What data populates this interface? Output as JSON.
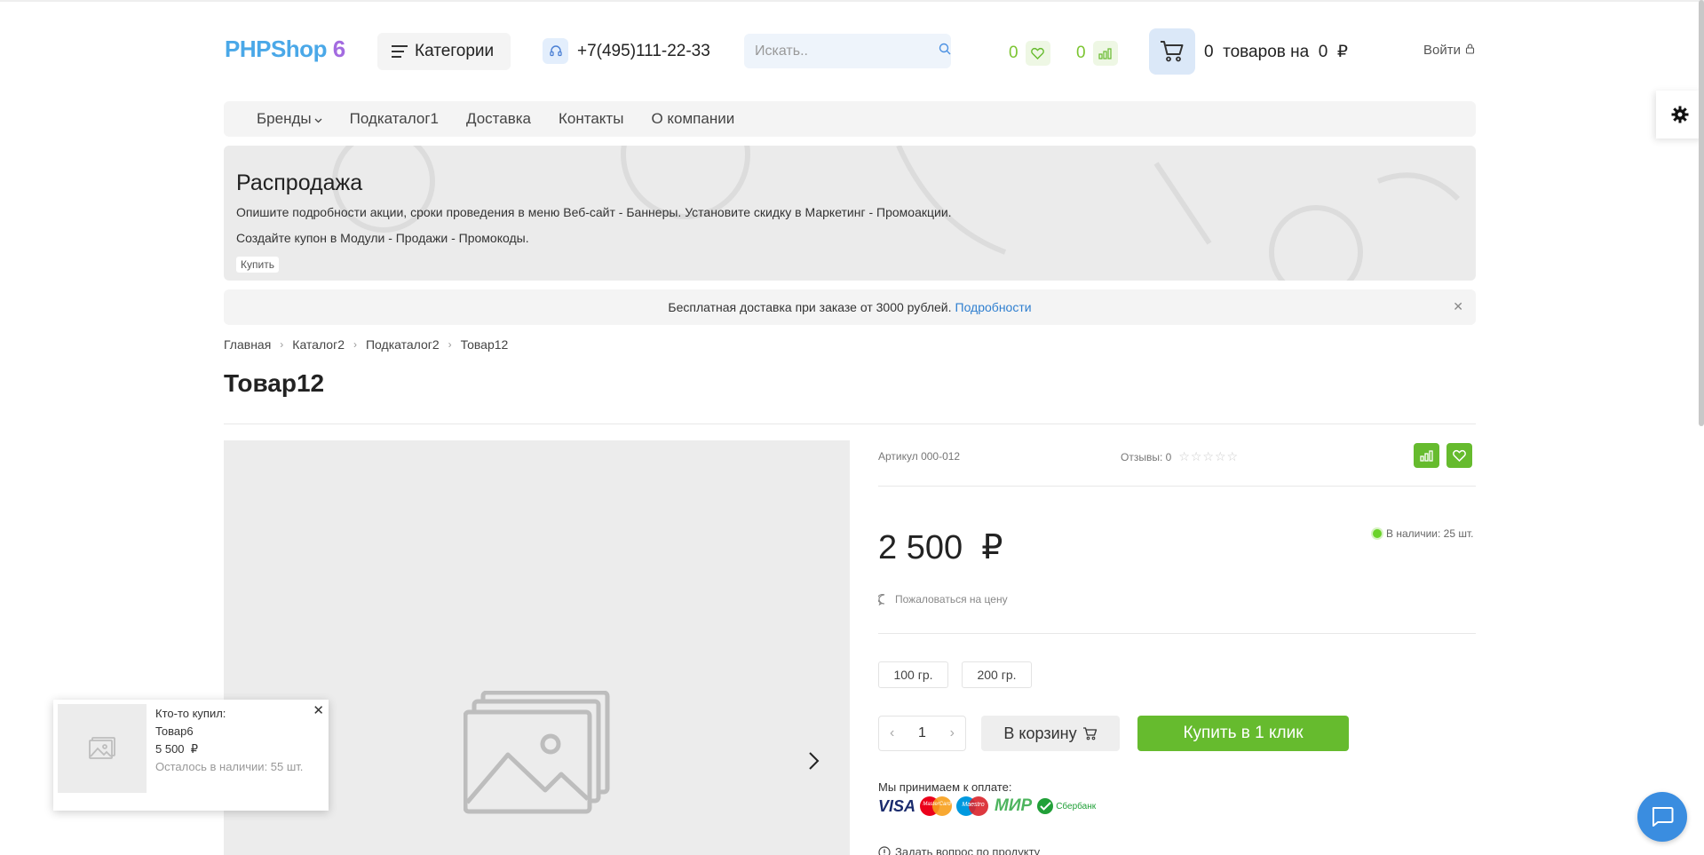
{
  "header": {
    "logo_part1": "PHPShop",
    "logo_part2": "6",
    "categories_label": "Категории",
    "phone": "+7(495)111-22-33",
    "search_placeholder": "Искать..",
    "wishlist_count": "0",
    "compare_count": "0",
    "cart_text": "0  товаров на  0  ₽",
    "login_label": "Войти"
  },
  "nav": {
    "items": [
      {
        "label": "Бренды"
      },
      {
        "label": "Подкаталог1"
      },
      {
        "label": "Доставка"
      },
      {
        "label": "Контакты"
      },
      {
        "label": "О компании"
      }
    ]
  },
  "banner": {
    "title": "Распродажа",
    "line1": "Опишите подробности акции, сроки проведения в меню Веб-сайт - Баннеры. Установите скидку в Маркетинг - Промоакции.",
    "line2": "Создайте купон в Модули - Продажи - Промокоды.",
    "button": "Купить"
  },
  "delivery": {
    "text": "Бесплатная доставка при заказе от 3000 рублей.",
    "link": "Подробности",
    "close": "✕"
  },
  "breadcrumb": {
    "items": [
      "Главная",
      "Каталог2",
      "Подкаталог2",
      "Товар12"
    ]
  },
  "product": {
    "title": "Товар12",
    "sku": "Артикул 000-012",
    "reviews": "Отзывы: 0",
    "stars": "☆☆☆☆☆",
    "price": "2 500  ₽",
    "stock": "В наличии: 25 шт.",
    "complain": "Пожаловаться на цену",
    "options": [
      "100 гр.",
      "200 гр."
    ],
    "qty": "1",
    "to_cart": "В корзину",
    "one_click": "Купить в 1 клик",
    "pay_label": "Мы принимаем к оплате:",
    "pay_logos": [
      "VISA",
      "MasterCard",
      "Maestro",
      "МИР",
      "Сбербанк"
    ],
    "ask": "Задать вопрос по продукту"
  },
  "popup": {
    "line1": "Кто-то купил:",
    "line2": "Товар6",
    "line3": "5 500  ₽",
    "line4": "Осталось в наличии: 55 шт.",
    "close": "✕"
  },
  "colors": {
    "accent_green": "#66bb2e",
    "accent_blue": "#3a8de0",
    "link_blue": "#2f7fd0"
  }
}
